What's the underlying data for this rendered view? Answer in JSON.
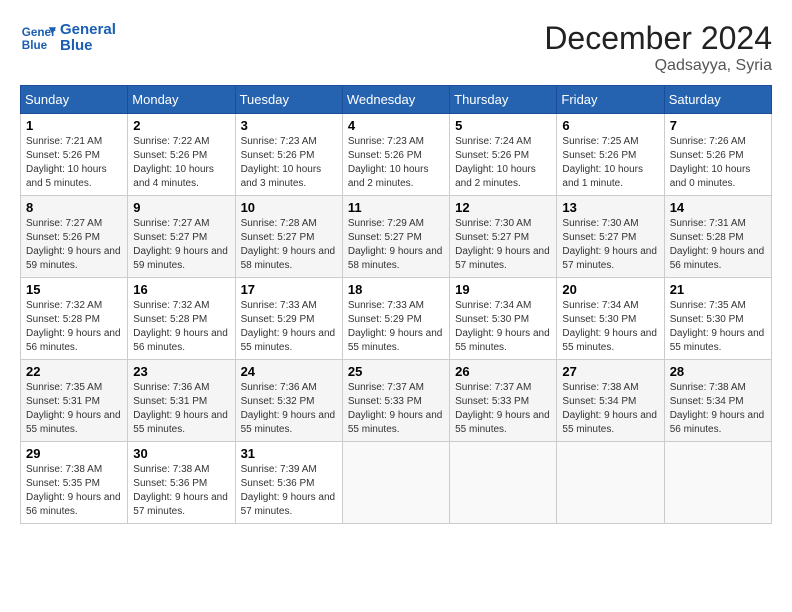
{
  "header": {
    "logo_line1": "General",
    "logo_line2": "Blue",
    "month_year": "December 2024",
    "location": "Qadsayya, Syria"
  },
  "weekdays": [
    "Sunday",
    "Monday",
    "Tuesday",
    "Wednesday",
    "Thursday",
    "Friday",
    "Saturday"
  ],
  "weeks": [
    [
      {
        "day": "1",
        "sunrise": "Sunrise: 7:21 AM",
        "sunset": "Sunset: 5:26 PM",
        "daylight": "Daylight: 10 hours and 5 minutes."
      },
      {
        "day": "2",
        "sunrise": "Sunrise: 7:22 AM",
        "sunset": "Sunset: 5:26 PM",
        "daylight": "Daylight: 10 hours and 4 minutes."
      },
      {
        "day": "3",
        "sunrise": "Sunrise: 7:23 AM",
        "sunset": "Sunset: 5:26 PM",
        "daylight": "Daylight: 10 hours and 3 minutes."
      },
      {
        "day": "4",
        "sunrise": "Sunrise: 7:23 AM",
        "sunset": "Sunset: 5:26 PM",
        "daylight": "Daylight: 10 hours and 2 minutes."
      },
      {
        "day": "5",
        "sunrise": "Sunrise: 7:24 AM",
        "sunset": "Sunset: 5:26 PM",
        "daylight": "Daylight: 10 hours and 2 minutes."
      },
      {
        "day": "6",
        "sunrise": "Sunrise: 7:25 AM",
        "sunset": "Sunset: 5:26 PM",
        "daylight": "Daylight: 10 hours and 1 minute."
      },
      {
        "day": "7",
        "sunrise": "Sunrise: 7:26 AM",
        "sunset": "Sunset: 5:26 PM",
        "daylight": "Daylight: 10 hours and 0 minutes."
      }
    ],
    [
      {
        "day": "8",
        "sunrise": "Sunrise: 7:27 AM",
        "sunset": "Sunset: 5:26 PM",
        "daylight": "Daylight: 9 hours and 59 minutes."
      },
      {
        "day": "9",
        "sunrise": "Sunrise: 7:27 AM",
        "sunset": "Sunset: 5:27 PM",
        "daylight": "Daylight: 9 hours and 59 minutes."
      },
      {
        "day": "10",
        "sunrise": "Sunrise: 7:28 AM",
        "sunset": "Sunset: 5:27 PM",
        "daylight": "Daylight: 9 hours and 58 minutes."
      },
      {
        "day": "11",
        "sunrise": "Sunrise: 7:29 AM",
        "sunset": "Sunset: 5:27 PM",
        "daylight": "Daylight: 9 hours and 58 minutes."
      },
      {
        "day": "12",
        "sunrise": "Sunrise: 7:30 AM",
        "sunset": "Sunset: 5:27 PM",
        "daylight": "Daylight: 9 hours and 57 minutes."
      },
      {
        "day": "13",
        "sunrise": "Sunrise: 7:30 AM",
        "sunset": "Sunset: 5:27 PM",
        "daylight": "Daylight: 9 hours and 57 minutes."
      },
      {
        "day": "14",
        "sunrise": "Sunrise: 7:31 AM",
        "sunset": "Sunset: 5:28 PM",
        "daylight": "Daylight: 9 hours and 56 minutes."
      }
    ],
    [
      {
        "day": "15",
        "sunrise": "Sunrise: 7:32 AM",
        "sunset": "Sunset: 5:28 PM",
        "daylight": "Daylight: 9 hours and 56 minutes."
      },
      {
        "day": "16",
        "sunrise": "Sunrise: 7:32 AM",
        "sunset": "Sunset: 5:28 PM",
        "daylight": "Daylight: 9 hours and 56 minutes."
      },
      {
        "day": "17",
        "sunrise": "Sunrise: 7:33 AM",
        "sunset": "Sunset: 5:29 PM",
        "daylight": "Daylight: 9 hours and 55 minutes."
      },
      {
        "day": "18",
        "sunrise": "Sunrise: 7:33 AM",
        "sunset": "Sunset: 5:29 PM",
        "daylight": "Daylight: 9 hours and 55 minutes."
      },
      {
        "day": "19",
        "sunrise": "Sunrise: 7:34 AM",
        "sunset": "Sunset: 5:30 PM",
        "daylight": "Daylight: 9 hours and 55 minutes."
      },
      {
        "day": "20",
        "sunrise": "Sunrise: 7:34 AM",
        "sunset": "Sunset: 5:30 PM",
        "daylight": "Daylight: 9 hours and 55 minutes."
      },
      {
        "day": "21",
        "sunrise": "Sunrise: 7:35 AM",
        "sunset": "Sunset: 5:30 PM",
        "daylight": "Daylight: 9 hours and 55 minutes."
      }
    ],
    [
      {
        "day": "22",
        "sunrise": "Sunrise: 7:35 AM",
        "sunset": "Sunset: 5:31 PM",
        "daylight": "Daylight: 9 hours and 55 minutes."
      },
      {
        "day": "23",
        "sunrise": "Sunrise: 7:36 AM",
        "sunset": "Sunset: 5:31 PM",
        "daylight": "Daylight: 9 hours and 55 minutes."
      },
      {
        "day": "24",
        "sunrise": "Sunrise: 7:36 AM",
        "sunset": "Sunset: 5:32 PM",
        "daylight": "Daylight: 9 hours and 55 minutes."
      },
      {
        "day": "25",
        "sunrise": "Sunrise: 7:37 AM",
        "sunset": "Sunset: 5:33 PM",
        "daylight": "Daylight: 9 hours and 55 minutes."
      },
      {
        "day": "26",
        "sunrise": "Sunrise: 7:37 AM",
        "sunset": "Sunset: 5:33 PM",
        "daylight": "Daylight: 9 hours and 55 minutes."
      },
      {
        "day": "27",
        "sunrise": "Sunrise: 7:38 AM",
        "sunset": "Sunset: 5:34 PM",
        "daylight": "Daylight: 9 hours and 55 minutes."
      },
      {
        "day": "28",
        "sunrise": "Sunrise: 7:38 AM",
        "sunset": "Sunset: 5:34 PM",
        "daylight": "Daylight: 9 hours and 56 minutes."
      }
    ],
    [
      {
        "day": "29",
        "sunrise": "Sunrise: 7:38 AM",
        "sunset": "Sunset: 5:35 PM",
        "daylight": "Daylight: 9 hours and 56 minutes."
      },
      {
        "day": "30",
        "sunrise": "Sunrise: 7:38 AM",
        "sunset": "Sunset: 5:36 PM",
        "daylight": "Daylight: 9 hours and 57 minutes."
      },
      {
        "day": "31",
        "sunrise": "Sunrise: 7:39 AM",
        "sunset": "Sunset: 5:36 PM",
        "daylight": "Daylight: 9 hours and 57 minutes."
      },
      null,
      null,
      null,
      null
    ]
  ]
}
